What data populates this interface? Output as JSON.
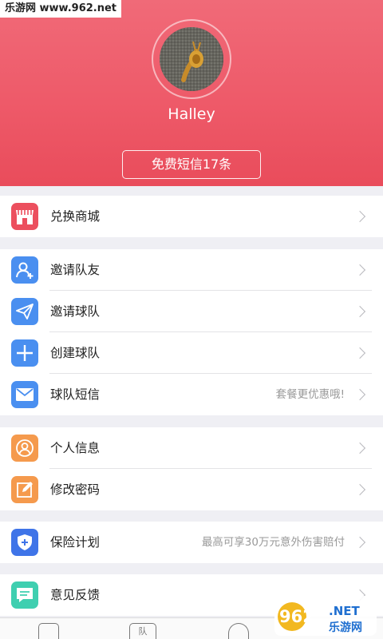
{
  "watermark_top": "乐游网 www.962.net",
  "profile": {
    "username": "Halley",
    "sms_button": "免费短信17条"
  },
  "groups": [
    {
      "rows": [
        {
          "id": "shop",
          "label": "兑换商城",
          "hint": "",
          "icon": "store-icon",
          "color": "#ec4f5e"
        }
      ]
    },
    {
      "rows": [
        {
          "id": "invite-member",
          "label": "邀请队友",
          "hint": "",
          "icon": "add-user-icon",
          "color": "#4a8ff0"
        },
        {
          "id": "invite-team",
          "label": "邀请球队",
          "hint": "",
          "icon": "paper-plane-icon",
          "color": "#4a8ff0"
        },
        {
          "id": "create-team",
          "label": "创建球队",
          "hint": "",
          "icon": "plus-icon",
          "color": "#4a8ff0"
        },
        {
          "id": "team-sms",
          "label": "球队短信",
          "hint": "套餐更优惠哦!",
          "icon": "mail-icon",
          "color": "#4a8ff0"
        }
      ]
    },
    {
      "rows": [
        {
          "id": "profile-info",
          "label": "个人信息",
          "hint": "",
          "icon": "person-icon",
          "color": "#f59a4d"
        },
        {
          "id": "change-password",
          "label": "修改密码",
          "hint": "",
          "icon": "edit-icon",
          "color": "#f59a4d"
        }
      ]
    },
    {
      "rows": [
        {
          "id": "insurance",
          "label": "保险计划",
          "hint": "最高可享30万元意外伤害赔付",
          "icon": "shield-plus-icon",
          "color": "#3f74e8"
        }
      ]
    },
    {
      "rows": [
        {
          "id": "feedback",
          "label": "意见反馈",
          "hint": "",
          "icon": "chat-icon",
          "color": "#3fcfb0"
        }
      ]
    }
  ],
  "tabbar": {
    "tab2_text": "队"
  },
  "watermark_logo": {
    "text": "962",
    "suffix": ".NET",
    "sub": "乐游网"
  }
}
